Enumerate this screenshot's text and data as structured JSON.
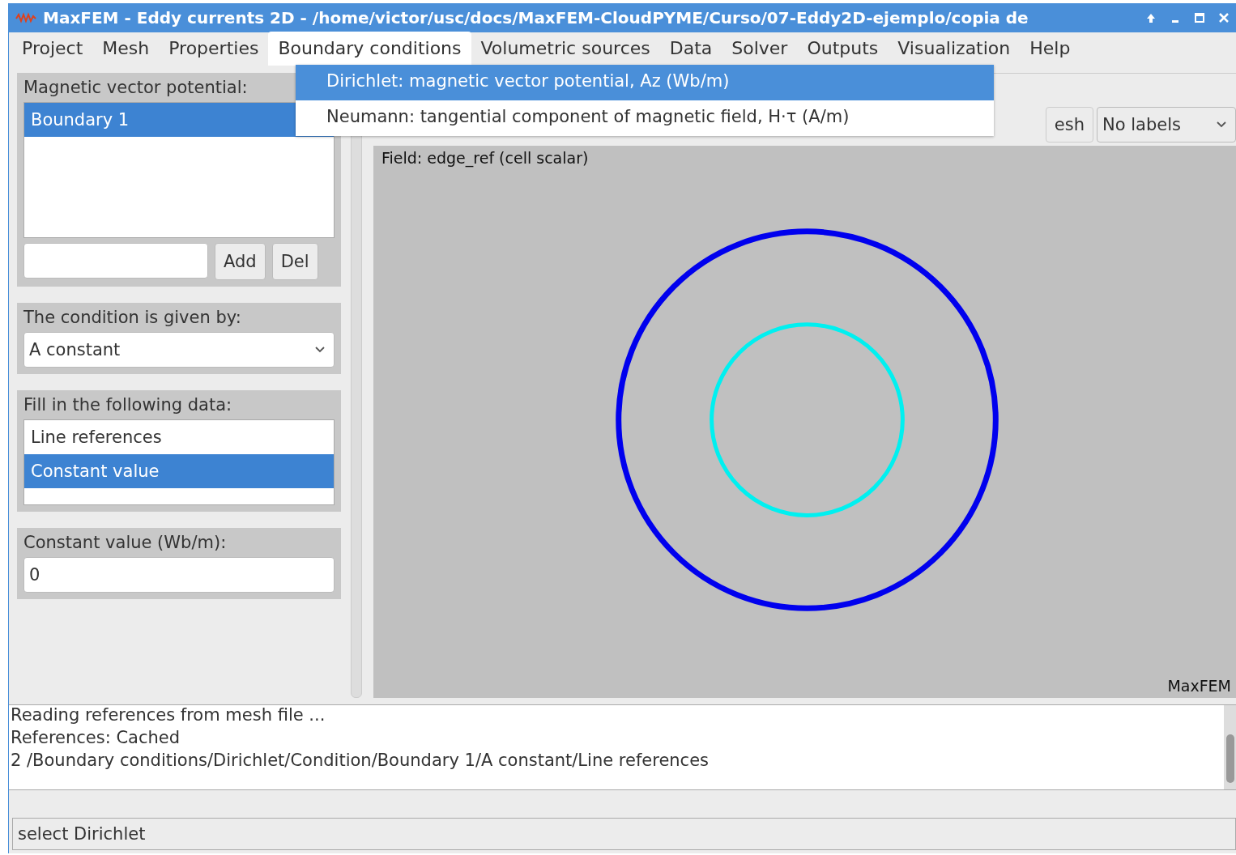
{
  "window": {
    "title": "MaxFEM - Eddy currents 2D - /home/victor/usc/docs/MaxFEM-CloudPYME/Curso/07-Eddy2D-ejemplo/copia de"
  },
  "menu_bar": [
    {
      "label": "Project",
      "selected": false
    },
    {
      "label": "Mesh",
      "selected": false
    },
    {
      "label": "Properties",
      "selected": false
    },
    {
      "label": "Boundary conditions",
      "selected": true
    },
    {
      "label": "Volumetric sources",
      "selected": false
    },
    {
      "label": "Data",
      "selected": false
    },
    {
      "label": "Solver",
      "selected": false
    },
    {
      "label": "Outputs",
      "selected": false
    },
    {
      "label": "Visualization",
      "selected": false
    },
    {
      "label": "Help",
      "selected": false
    }
  ],
  "dropdown_menu": [
    {
      "label": "Dirichlet: magnetic vector potential, Az (Wb/m)",
      "selected": true
    },
    {
      "label": "Neumann: tangential component of magnetic field, H·τ (A/m)",
      "selected": false
    }
  ],
  "boundaries": {
    "title": "Magnetic vector potential:",
    "items": [
      {
        "label": "Boundary 1",
        "selected": true
      }
    ],
    "buttons": [
      "Add",
      "Del"
    ]
  },
  "condition": {
    "title": "The condition is given by:",
    "value": "A constant"
  },
  "data": {
    "title": "Fill in the following data:",
    "items": [
      {
        "label": "Line references",
        "selected": false
      },
      {
        "label": "Constant value",
        "selected": true
      }
    ]
  },
  "constant": {
    "title": "Constant value (Wb/m):",
    "value": "0"
  },
  "toolbar": {
    "button": "esh",
    "labels_select": "No labels"
  },
  "canvas": {
    "field_label": "Field: edge_ref (cell scalar)",
    "watermark": "MaxFEM"
  },
  "log": [
    "Reading references from mesh file ...",
    "References: Cached",
    "2 /Boundary conditions/Dirichlet/Condition/Boundary 1/A constant/Line references"
  ],
  "status_bar": "select Dirichlet"
}
